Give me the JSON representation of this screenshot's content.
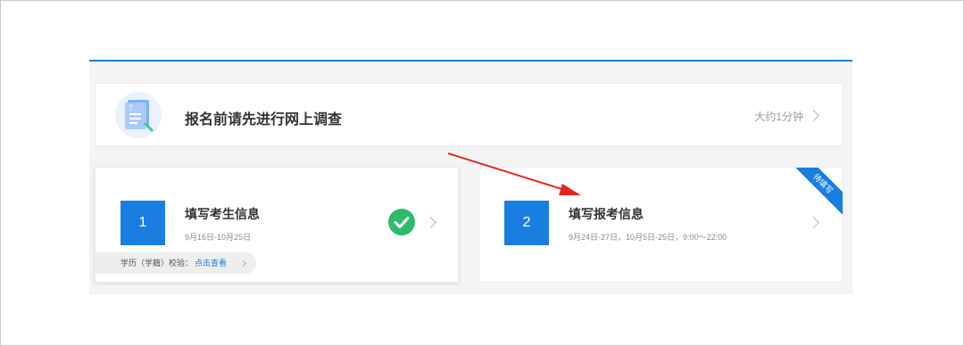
{
  "survey": {
    "title": "报名前请先进行网上调查",
    "duration": "大约1分钟",
    "icon": "survey-document-icon"
  },
  "steps": [
    {
      "number": "1",
      "title": "填写考生信息",
      "date": "9月16日-10月25日",
      "status_icon": "check-circle-icon",
      "verify_label": "学历（学籍）校验：",
      "verify_link": "点击查看"
    },
    {
      "number": "2",
      "title": "填写报考信息",
      "date": "9月24日-27日，10月5日-25日，9:00～22:00",
      "badge": "待填写"
    }
  ],
  "colors": {
    "accent": "#1a7ee0",
    "success": "#2dbb6c",
    "annotation_arrow": "#e8261f"
  }
}
